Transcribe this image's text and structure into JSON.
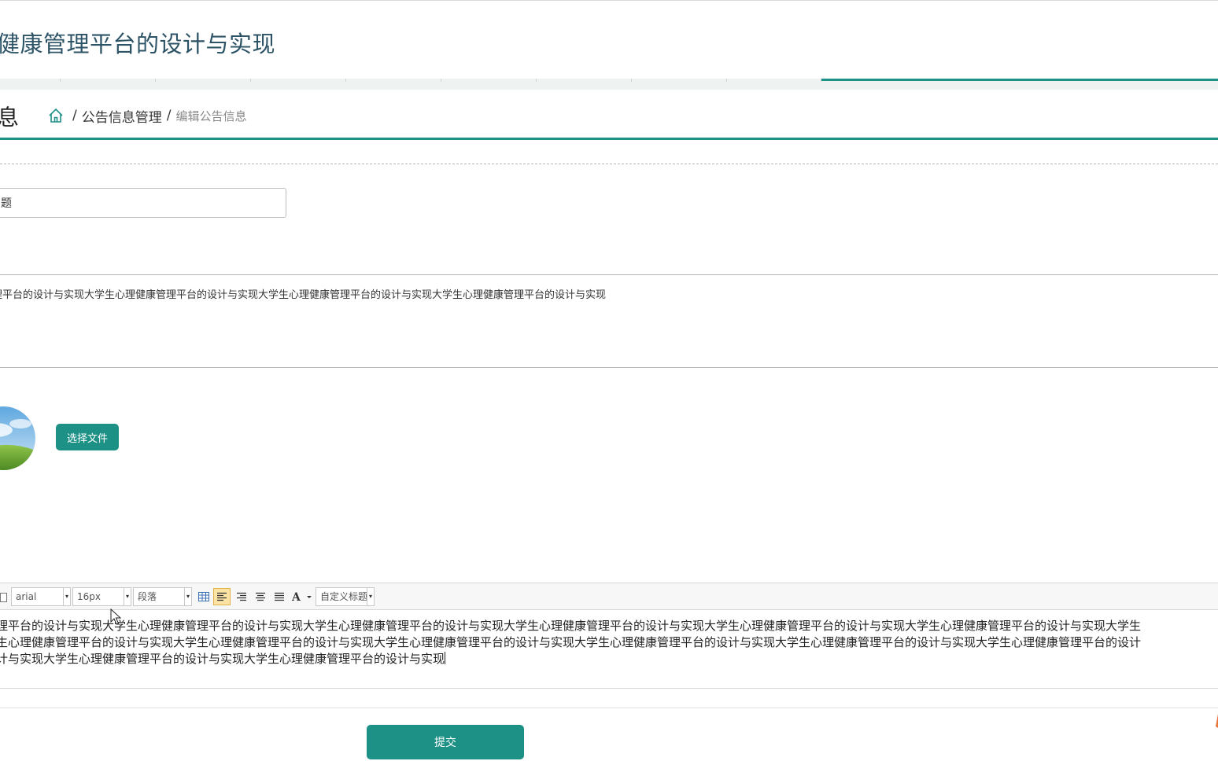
{
  "app": {
    "title": "健康管理平台的设计与实现"
  },
  "nav": {
    "active_color": "#1e9187"
  },
  "page": {
    "section_title": "息",
    "breadcrumb": {
      "home_icon": "home-icon",
      "separator": "/",
      "parent": "公告信息管理",
      "current": "编辑公告信息"
    }
  },
  "form": {
    "title_value": "题",
    "summary_text": "理平台的设计与实现大学生心理健康管理平台的设计与实现大学生心理健康管理平台的设计与实现大学生心理健康管理平台的设计与实现",
    "choose_file_label": "选择文件",
    "submit_label": "提交"
  },
  "editor": {
    "font_family": "arial",
    "font_size": "16px",
    "paragraph": "段落",
    "custom_heading": "自定义标题",
    "lines": [
      "理平台的设计与实现大学生心理健康管理平台的设计与实现大学生心理健康管理平台的设计与实现大学生心理健康管理平台的设计与实现大学生心理健康管理平台的设计与实现大学生心理健康管理平台的设计与实现大学生",
      "生心理健康管理平台的设计与实现大学生心理健康管理平台的设计与实现大学生心理健康管理平台的设计与实现大学生心理健康管理平台的设计与实现大学生心理健康管理平台的设计与实现大学生心理健康管理平台的设计",
      "计与实现大学生心理健康管理平台的设计与实现大学生心理健康管理平台的设计与实现"
    ]
  },
  "colors": {
    "primary": "#1e9187",
    "title": "#2c5366"
  }
}
